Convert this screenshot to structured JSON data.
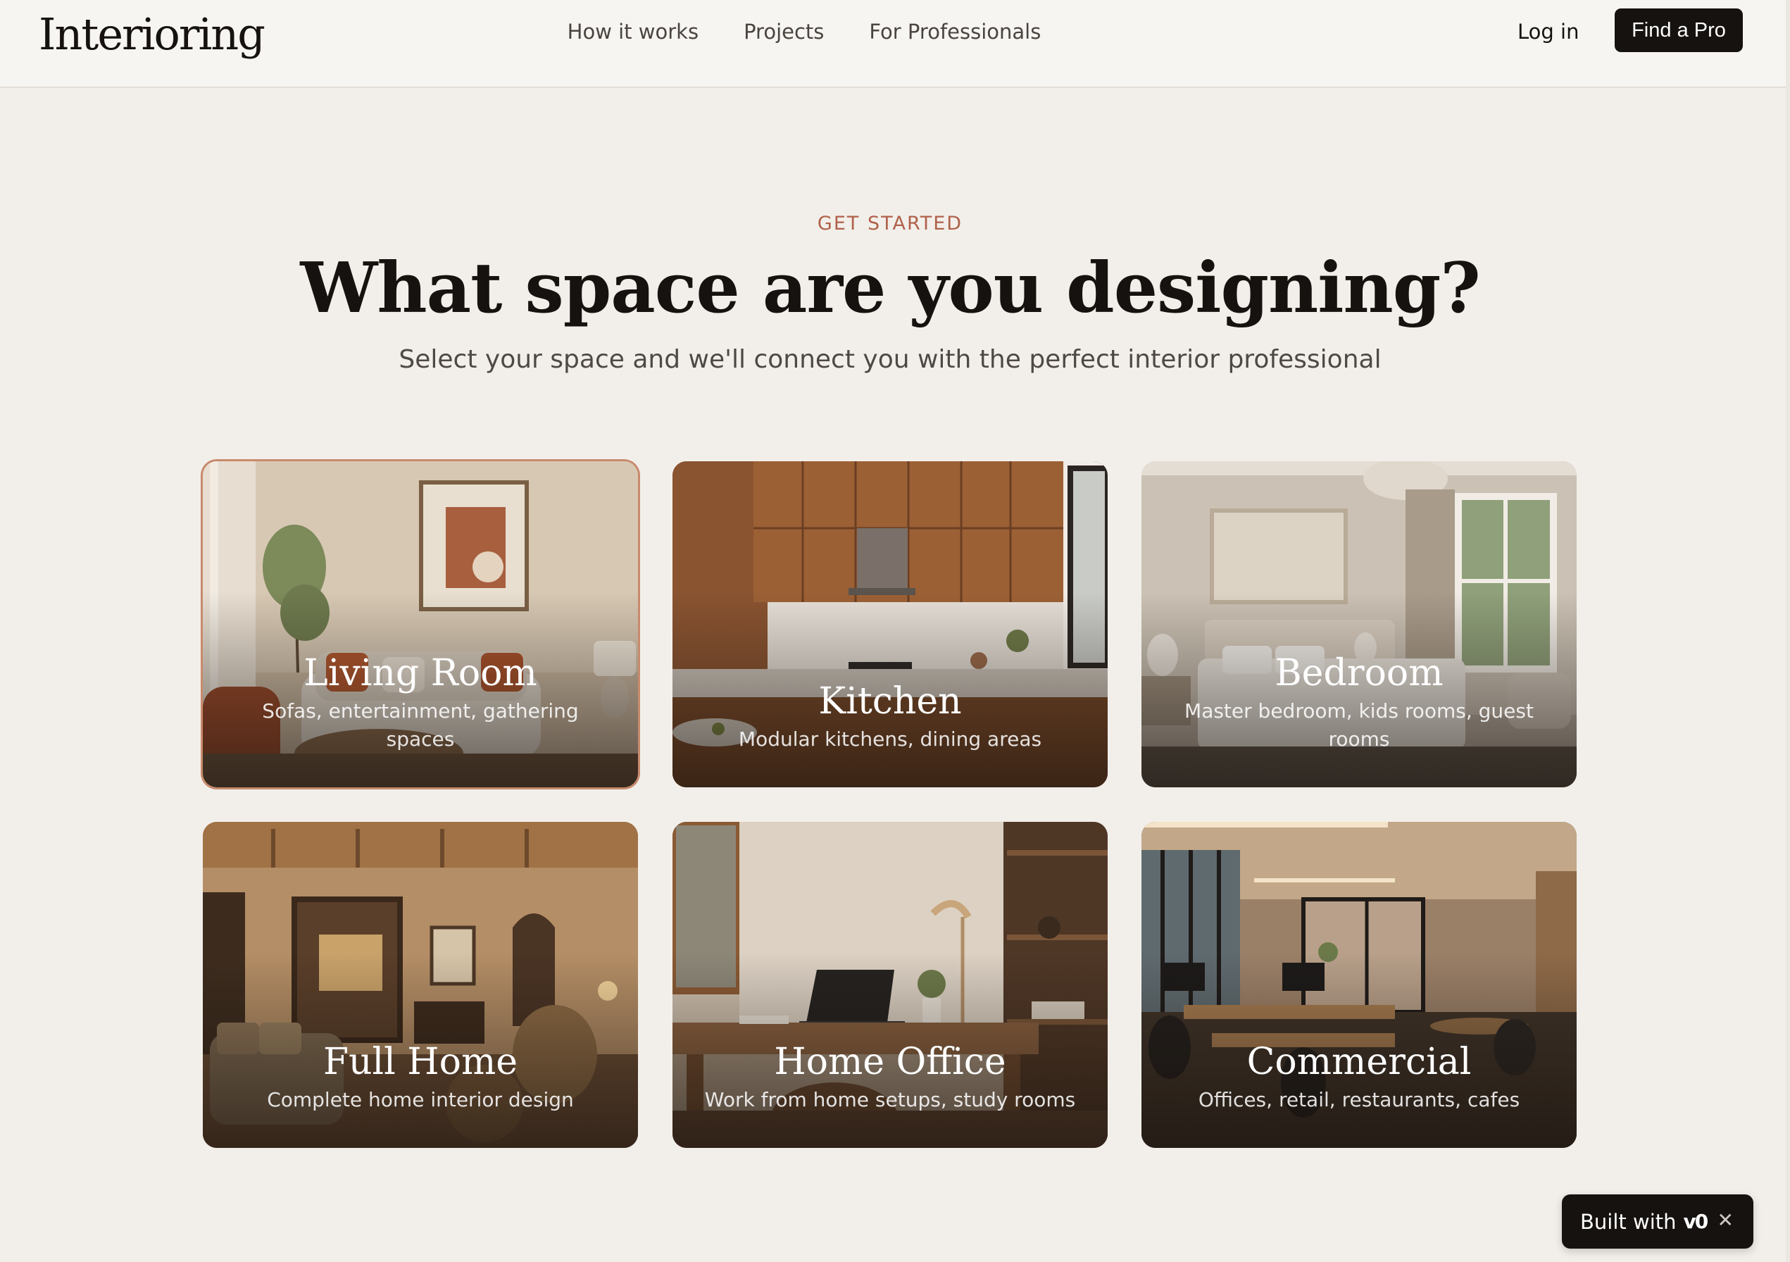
{
  "header": {
    "logo": "Interioring",
    "nav": [
      "How it works",
      "Projects",
      "For Professionals"
    ],
    "login_label": "Log in",
    "cta_label": "Find a Pro"
  },
  "hero": {
    "eyebrow": "GET STARTED",
    "title": "What space are you designing?",
    "subtitle": "Select your space and we'll connect you with the perfect interior professional"
  },
  "spaces": [
    {
      "title": "Living Room",
      "description": "Sofas, entertainment, gathering spaces",
      "selected": true
    },
    {
      "title": "Kitchen",
      "description": "Modular kitchens, dining areas",
      "selected": false
    },
    {
      "title": "Bedroom",
      "description": "Master bedroom, kids rooms, guest rooms",
      "selected": false
    },
    {
      "title": "Full Home",
      "description": "Complete home interior design",
      "selected": false
    },
    {
      "title": "Home Office",
      "description": "Work from home setups, study rooms",
      "selected": false
    },
    {
      "title": "Commercial",
      "description": "Offices, retail, restaurants, cafes",
      "selected": false
    }
  ],
  "badge": {
    "label": "Built with",
    "mark": "v0",
    "close_icon": "close-icon"
  },
  "colors": {
    "background": "#f2efea",
    "accent": "#b0614a",
    "primary_button": "#16120f"
  }
}
